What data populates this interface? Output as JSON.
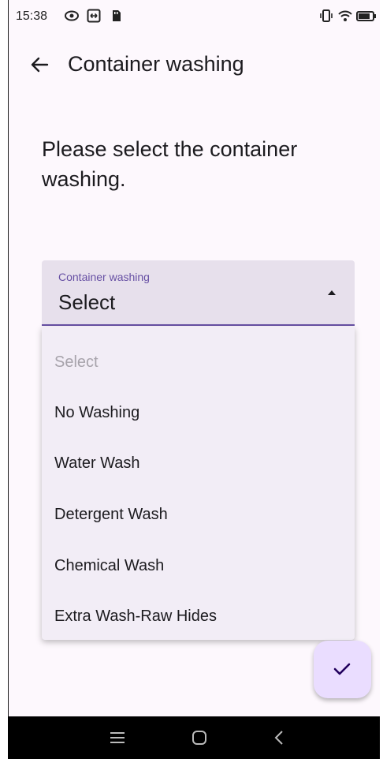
{
  "status_bar": {
    "time": "15:38"
  },
  "app_bar": {
    "title": "Container washing"
  },
  "prompt": "Please select the container washing.",
  "select": {
    "label": "Container washing",
    "value": "Select"
  },
  "menu": {
    "items": [
      "Select",
      "No Washing",
      "Water Wash",
      "Detergent Wash",
      "Chemical Wash",
      "Extra Wash-Raw Hides"
    ]
  },
  "icons": {
    "back": "arrow-back-icon",
    "fab": "check-icon",
    "nav": [
      "menu-icon",
      "home-icon",
      "back-chevron-icon"
    ]
  },
  "colors": {
    "accent": "#6750a4",
    "fab_bg": "#eaddff",
    "field_bg": "#e7e0ec",
    "menu_bg": "#f2edf6"
  }
}
